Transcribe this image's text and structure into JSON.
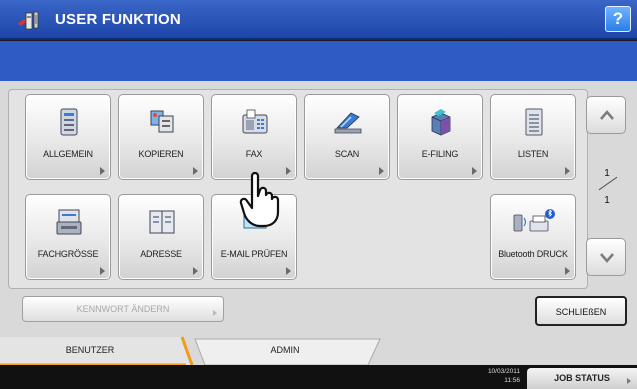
{
  "window": {
    "title": "USER FUNKTION",
    "help_label": "?"
  },
  "tiles": [
    {
      "id": "allgemein",
      "label": "ALLGEMEIN",
      "icon": "settings-doc-icon"
    },
    {
      "id": "kopieren",
      "label": "KOPIEREN",
      "icon": "copier-icon"
    },
    {
      "id": "fax",
      "label": "FAX",
      "icon": "fax-icon"
    },
    {
      "id": "scan",
      "label": "SCAN",
      "icon": "scanner-icon"
    },
    {
      "id": "efiling",
      "label": "E-FILING",
      "icon": "efiling-box-icon"
    },
    {
      "id": "listen",
      "label": "LISTEN",
      "icon": "list-doc-icon"
    },
    {
      "id": "fachgroesse",
      "label": "FACHGRÖSSE",
      "icon": "paper-tray-icon"
    },
    {
      "id": "adresse",
      "label": "ADRESSE",
      "icon": "address-book-icon"
    },
    {
      "id": "emailpruefen",
      "label": "E-MAIL PRÜFEN",
      "icon": "email-check-icon"
    },
    {
      "id": "bluetooth",
      "label": "Bluetooth DRUCK",
      "icon": "bluetooth-print-icon"
    }
  ],
  "pager": {
    "current": "1",
    "total": "1"
  },
  "buttons": {
    "change_password": "KENNWORT ÄNDERN",
    "close": "SCHLIEßEN"
  },
  "tabs": [
    {
      "label": "BENUTZER",
      "active": true
    },
    {
      "label": "ADMIN",
      "active": false
    }
  ],
  "status": {
    "date": "10/03/2011",
    "time": "11:56",
    "job_status": "JOB STATUS"
  },
  "colors": {
    "title_bar": "#2b57be",
    "band": "#2d5cc4",
    "tab_accent": "#f29a1a"
  }
}
